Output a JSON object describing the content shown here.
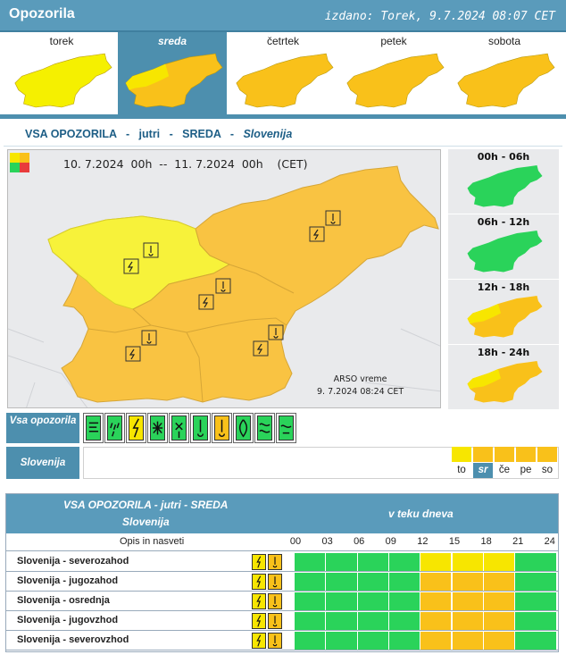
{
  "header": {
    "title": "Opozorila",
    "issued": "izdano: Torek, 9.7.2024 08:07 CET"
  },
  "days": [
    {
      "label": "torek",
      "active": false,
      "fill": "#f5f000"
    },
    {
      "label": "sreda",
      "active": true,
      "fill": "#f9c11a"
    },
    {
      "label": "četrtek",
      "active": false,
      "fill": "#f9c11a"
    },
    {
      "label": "petek",
      "active": false,
      "fill": "#f9c11a"
    },
    {
      "label": "sobota",
      "active": false,
      "fill": "#f9c11a"
    }
  ],
  "section": {
    "part1": "VSA OPOZORILA   -   jutri   -   SREDA   -   ",
    "region": "Slovenija"
  },
  "main_map": {
    "period": "10. 7.2024  00h  --  11. 7.2024  00h    (CET)",
    "credit_source": "ARSO vreme",
    "credit_time": "9. 7.2024  08:24 CET",
    "colors": {
      "yellow": "#f7f23a",
      "orange": "#f9c342"
    }
  },
  "time_maps": [
    {
      "label": "00h - 06h",
      "fill": "#2ad35a"
    },
    {
      "label": "06h - 12h",
      "fill": "#2ad35a"
    },
    {
      "label": "12h - 18h",
      "fill": "#f9c11a"
    },
    {
      "label": "18h - 24h",
      "fill": "#f9c11a"
    }
  ],
  "filters": {
    "all_label": "Vsa opozorila",
    "region_label": "Slovenija",
    "hazards": [
      {
        "icon": "wind-icon",
        "color": "#2ad35a"
      },
      {
        "icon": "rain-icon",
        "color": "#2ad35a"
      },
      {
        "icon": "thunderstorm-icon",
        "color": "#f7e600"
      },
      {
        "icon": "snow-icon",
        "color": "#2ad35a"
      },
      {
        "icon": "snow-ice-icon",
        "color": "#2ad35a"
      },
      {
        "icon": "low-temperature-icon",
        "color": "#2ad35a"
      },
      {
        "icon": "high-temperature-icon",
        "color": "#f9c11a"
      },
      {
        "icon": "fire-icon",
        "color": "#2ad35a"
      },
      {
        "icon": "fog-icon",
        "color": "#2ad35a"
      },
      {
        "icon": "coastal-icon",
        "color": "#2ad35a"
      }
    ],
    "mini_days": [
      {
        "label": "to",
        "color": "#f7e600",
        "active": false
      },
      {
        "label": "sr",
        "color": "#f9c11a",
        "active": true
      },
      {
        "label": "če",
        "color": "#f9c11a",
        "active": false
      },
      {
        "label": "pe",
        "color": "#f9c11a",
        "active": false
      },
      {
        "label": "so",
        "color": "#f9c11a",
        "active": false
      }
    ]
  },
  "table": {
    "title1": "VSA OPOZORILA - jutri - SREDA",
    "title2": "Slovenija",
    "during_day": "v teku dneva",
    "col_desc": "Opis in nasveti",
    "hours": [
      "00",
      "03",
      "06",
      "09",
      "12",
      "15",
      "18",
      "21",
      "24"
    ],
    "rows": [
      {
        "name": "Slovenija - severozahod",
        "cells": [
          "#2ad35a",
          "#2ad35a",
          "#2ad35a",
          "#2ad35a",
          "#f7e600",
          "#f7e600",
          "#f7e600",
          "#2ad35a",
          "#2ad35a"
        ]
      },
      {
        "name": "Slovenija - jugozahod",
        "cells": [
          "#2ad35a",
          "#2ad35a",
          "#2ad35a",
          "#2ad35a",
          "#f9c11a",
          "#f9c11a",
          "#f9c11a",
          "#2ad35a",
          "#2ad35a"
        ]
      },
      {
        "name": "Slovenija - osrednja",
        "cells": [
          "#2ad35a",
          "#2ad35a",
          "#2ad35a",
          "#2ad35a",
          "#f9c11a",
          "#f9c11a",
          "#f9c11a",
          "#2ad35a",
          "#2ad35a"
        ]
      },
      {
        "name": "Slovenija - jugovzhod",
        "cells": [
          "#2ad35a",
          "#2ad35a",
          "#2ad35a",
          "#2ad35a",
          "#f9c11a",
          "#f9c11a",
          "#f9c11a",
          "#2ad35a",
          "#2ad35a"
        ]
      },
      {
        "name": "Slovenija - severovzhod",
        "cells": [
          "#2ad35a",
          "#2ad35a",
          "#2ad35a",
          "#2ad35a",
          "#f9c11a",
          "#f9c11a",
          "#f9c11a",
          "#2ad35a",
          "#2ad35a"
        ]
      }
    ]
  }
}
